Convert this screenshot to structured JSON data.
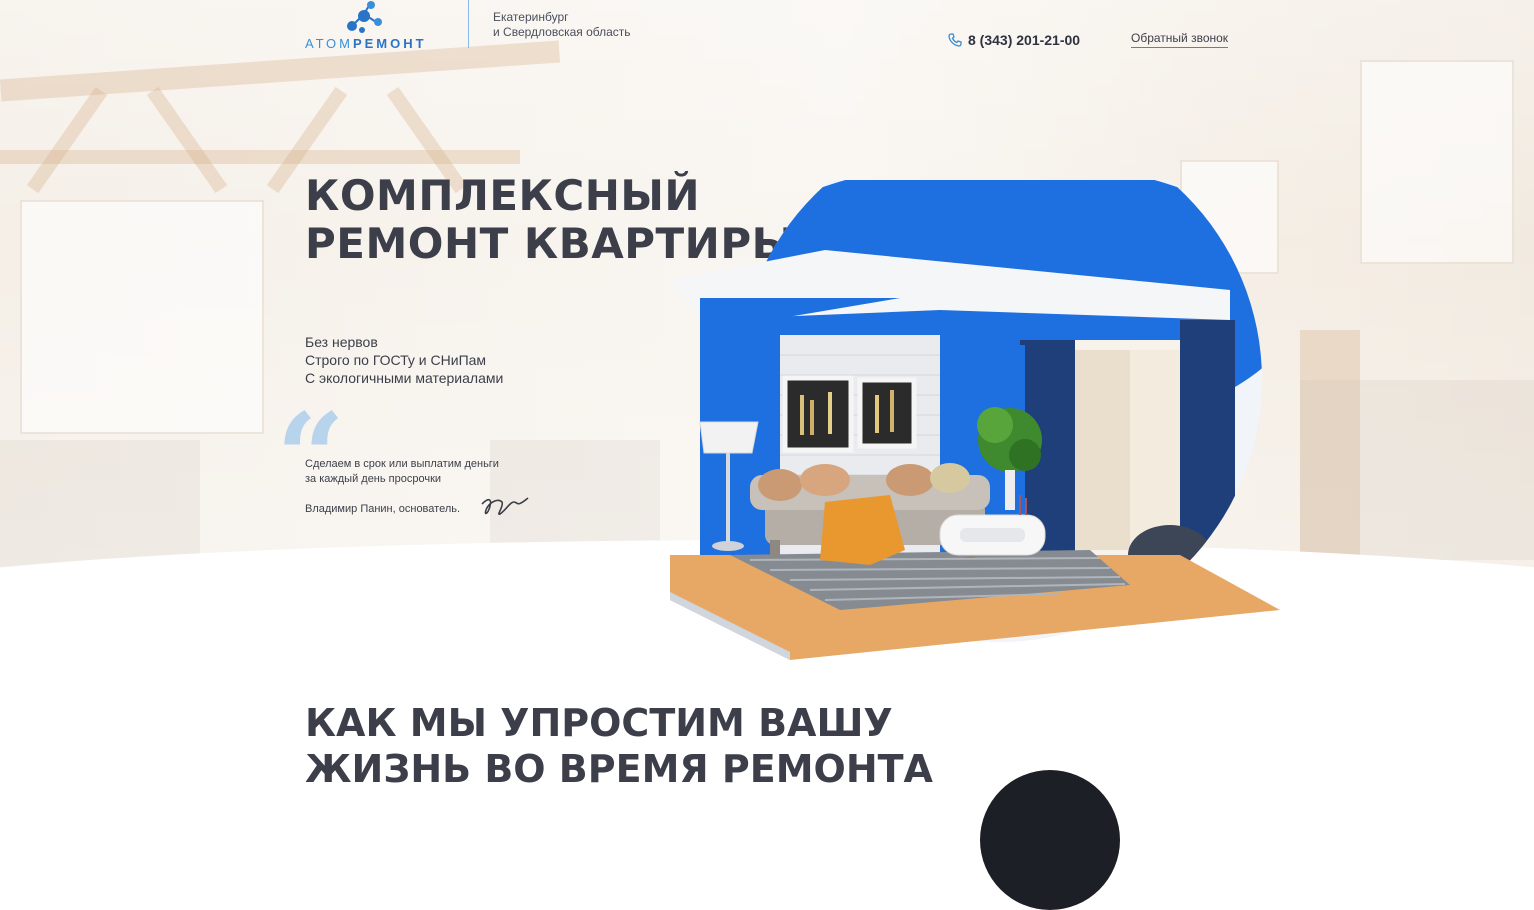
{
  "header": {
    "logo": {
      "part1": "АТОМ",
      "part2": "РЕМОНТ"
    },
    "region_line1": "Екатеринбург",
    "region_line2": "и Свердловская область",
    "phone": "8 (343) 201-21-00",
    "phone_icon": "phone-icon",
    "callback_label": "Обратный звонок"
  },
  "hero": {
    "title_line1": "КОМПЛЕКСНЫЙ",
    "title_line2": "РЕМОНТ КВАРТИРЫ",
    "benefits": [
      "Без нервов",
      "Строго по ГОСТу и СНиПам",
      "С экологичными материалами"
    ],
    "quote_line1": "Сделаем в срок или выплатим деньги",
    "quote_line2": "за каждый день просрочки",
    "author": "Владимир Панин, основатель."
  },
  "section2": {
    "title_line1": "КАК МЫ УПРОСТИМ ВАШУ",
    "title_line2": "ЖИЗНЬ ВО ВРЕМЯ РЕМОНТА"
  },
  "colors": {
    "accent_blue": "#1e6fe0",
    "logo_blue": "#2a74c8",
    "text_dark": "#3c3f4a"
  }
}
